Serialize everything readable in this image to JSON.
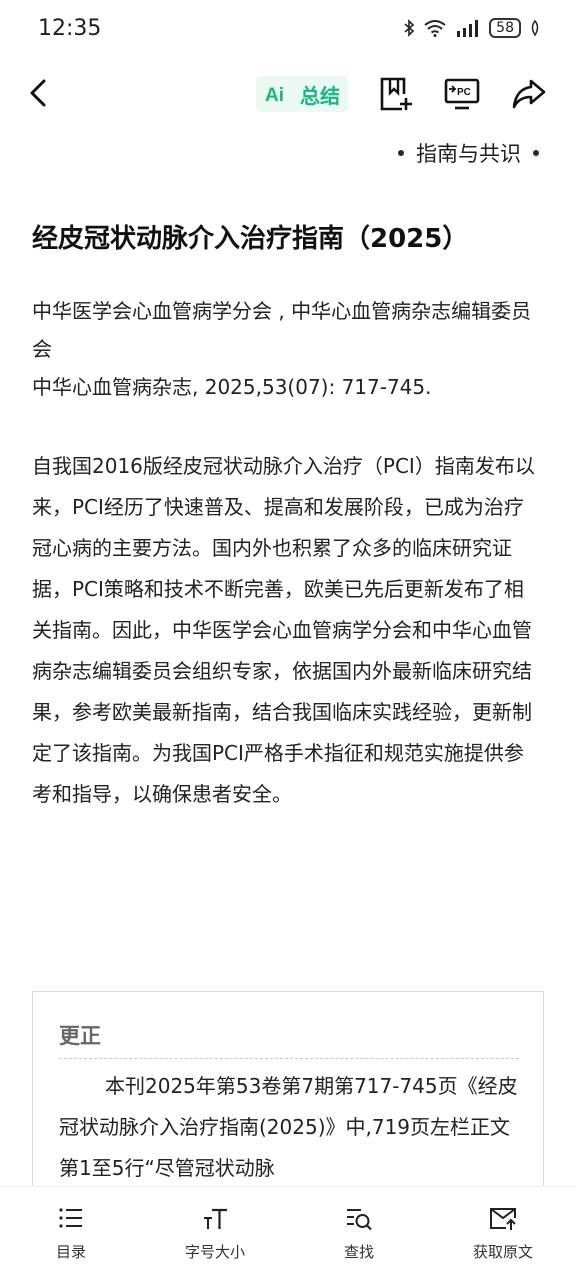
{
  "status_bar": {
    "time": "12:35",
    "battery": "58"
  },
  "toolbar": {
    "summary_label": "总结",
    "summary_icon_text": "Ai",
    "pc_icon_text": "PC"
  },
  "category": "指南与共识",
  "article": {
    "title": "经皮冠状动脉介入治疗指南（2025）",
    "authors": "中华医学会心血管病学分会 , 中华心血管病杂志编辑委员会",
    "citation": "中华心血管病杂志, 2025,53(07): 717-745.",
    "abstract": "自我国2016版经皮冠状动脉介入治疗（PCI）指南发布以来，PCI经历了快速普及、提高和发展阶段，已成为治疗冠心病的主要方法。国内外也积累了众多的临床研究证据，PCI策略和技术不断完善，欧美已先后更新发布了相关指南。因此，中华医学会心血管病学分会和中华心血管病杂志编辑委员会组织专家，依据国内外最新临床研究结果，参考欧美最新指南，结合我国临床实践经验，更新制定了该指南。为我国PCI严格手术指征和规范实施提供参考和指导，以确保患者安全。"
  },
  "correction": {
    "title": "更正",
    "text": "本刊2025年第53卷第7期第717-745页《经皮冠状动脉介入治疗指南(2025)》中,719页左栏正文第1至5行“尽管冠状动脉"
  },
  "bottom_nav": {
    "contents": "目录",
    "font_size": "字号大小",
    "find": "查找",
    "get_original": "获取原文"
  },
  "colors": {
    "accent_green": "#16b783"
  }
}
